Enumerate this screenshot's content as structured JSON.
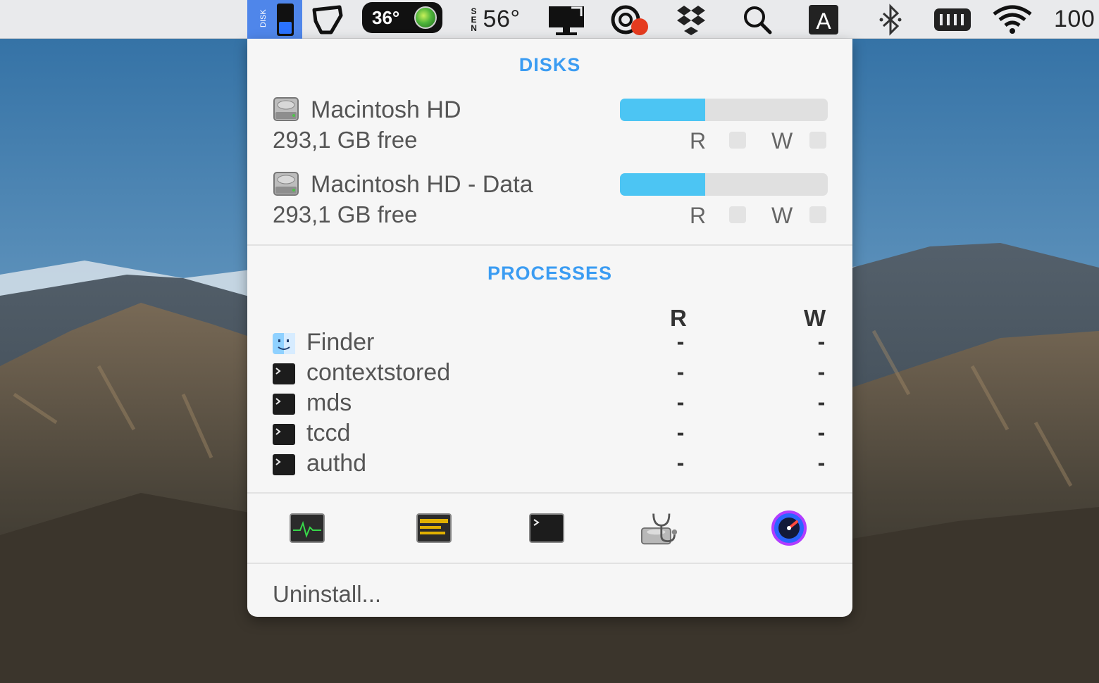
{
  "menubar": {
    "temperature_pill": "36°",
    "sensor_label": "56°",
    "battery_text": "100"
  },
  "popover": {
    "disks_title": "DISKS",
    "disks": [
      {
        "name": "Macintosh HD",
        "free": "293,1 GB free",
        "usage_fraction": 0.41,
        "read_label": "R",
        "write_label": "W"
      },
      {
        "name": "Macintosh HD - Data",
        "free": "293,1 GB free",
        "usage_fraction": 0.41,
        "read_label": "R",
        "write_label": "W"
      }
    ],
    "processes_title": "PROCESSES",
    "process_columns": {
      "read": "R",
      "write": "W"
    },
    "processes": [
      {
        "name": "Finder",
        "icon": "finder-icon",
        "read": "-",
        "write": "-"
      },
      {
        "name": "contextstored",
        "icon": "terminal-icon",
        "read": "-",
        "write": "-"
      },
      {
        "name": "mds",
        "icon": "terminal-icon",
        "read": "-",
        "write": "-"
      },
      {
        "name": "tccd",
        "icon": "terminal-icon",
        "read": "-",
        "write": "-"
      },
      {
        "name": "authd",
        "icon": "terminal-icon",
        "read": "-",
        "write": "-"
      }
    ],
    "tools": [
      {
        "name": "activity-monitor-icon"
      },
      {
        "name": "console-icon"
      },
      {
        "name": "terminal-icon"
      },
      {
        "name": "disk-utility-icon"
      },
      {
        "name": "istatistica-icon"
      }
    ],
    "uninstall_label": "Uninstall..."
  },
  "colors": {
    "accent": "#3b9cf2",
    "bar_fill": "#4cc5f3",
    "menubar_active": "#4f86ea"
  }
}
